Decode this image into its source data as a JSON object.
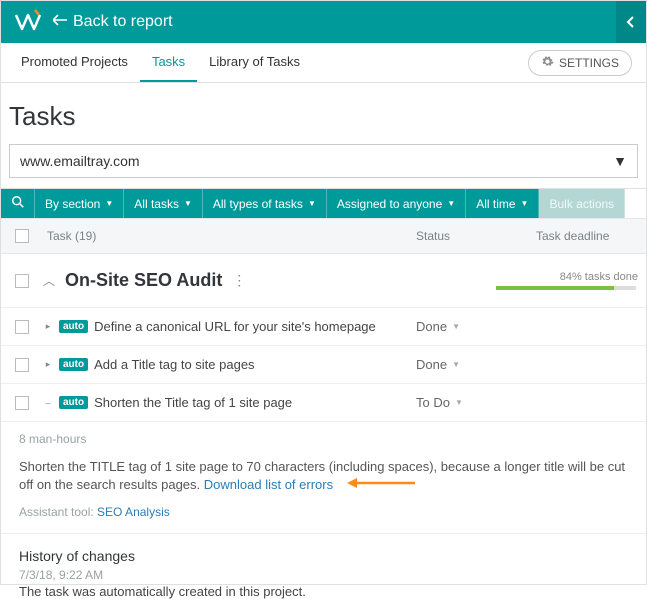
{
  "header": {
    "back_label": "Back to report"
  },
  "tabs": {
    "t0": "Promoted Projects",
    "t1": "Tasks",
    "t2": "Library of Tasks"
  },
  "settings_label": "SETTINGS",
  "page_title": "Tasks",
  "site_select": {
    "value": "www.emailtray.com"
  },
  "filters": {
    "by_section": "By section",
    "all_tasks": "All tasks",
    "all_types": "All types of tasks",
    "assigned": "Assigned to anyone",
    "all_time": "All time",
    "bulk": "Bulk actions"
  },
  "columns": {
    "task": "Task (19)",
    "status": "Status",
    "deadline": "Task deadline"
  },
  "group": {
    "name": "On-Site SEO Audit",
    "progress_text": "84% tasks done",
    "progress_percent": 84
  },
  "tasks": [
    {
      "auto": "auto",
      "title": "Define a canonical URL for your site's homepage",
      "status": "Done",
      "expanded": false
    },
    {
      "auto": "auto",
      "title": "Add a Title tag to site pages",
      "status": "Done",
      "expanded": false
    },
    {
      "auto": "auto",
      "title": "Shorten the Title tag of 1 site page",
      "status": "To Do",
      "expanded": true
    }
  ],
  "detail": {
    "man_hours": "8 man-hours",
    "description_a": "Shorten the TITLE tag of 1 site page to 70 characters (including spaces), because a longer title will be cut off on the search results pages. ",
    "download_link": "Download list of errors",
    "tool_label": "Assistant tool: ",
    "tool_link": "SEO Analysis"
  },
  "history": {
    "heading": "History of changes",
    "date": "7/3/18, 9:22 AM",
    "text": "The task was automatically created in this project."
  }
}
